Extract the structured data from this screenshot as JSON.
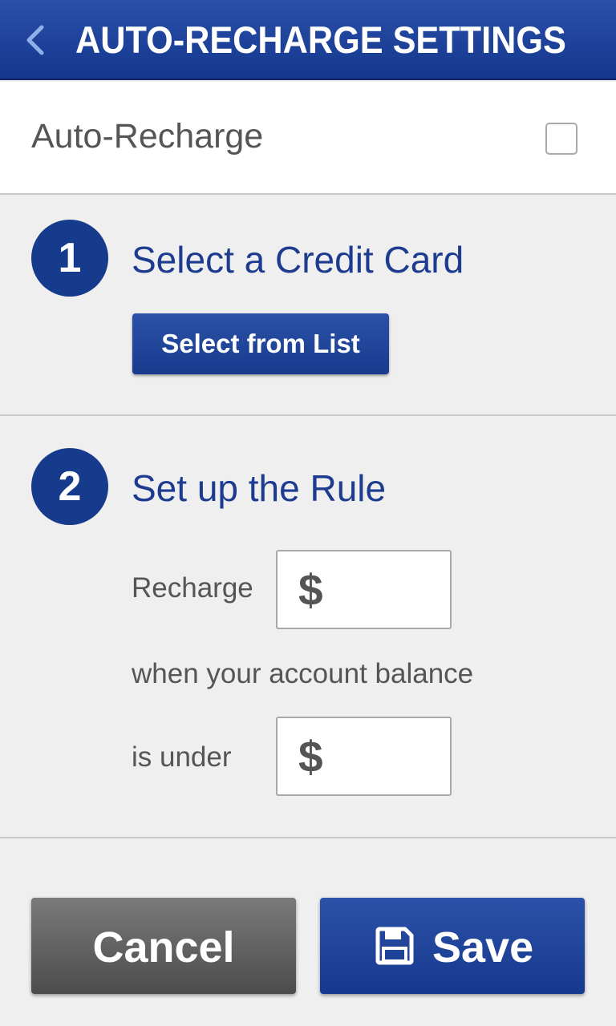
{
  "header": {
    "title": "AUTO-RECHARGE SETTINGS",
    "back_icon": "chevron-left-icon"
  },
  "auto_recharge": {
    "label": "Auto-Recharge",
    "checked": false
  },
  "step1": {
    "number": "1",
    "title": "Select a Credit Card",
    "button_label": "Select from List"
  },
  "step2": {
    "number": "2",
    "title": "Set up the Rule",
    "recharge_label": "Recharge",
    "balance_text": "when your account balance",
    "under_label": "is under",
    "currency_symbol": "$",
    "recharge_amount": "",
    "threshold_amount": ""
  },
  "footer": {
    "cancel_label": "Cancel",
    "save_label": "Save",
    "save_icon": "floppy-disk-icon"
  },
  "colors": {
    "brand_blue": "#163b8d",
    "header_blue": "#1f43a0",
    "cancel_gray": "#5e5e5e",
    "background": "#efefef"
  }
}
